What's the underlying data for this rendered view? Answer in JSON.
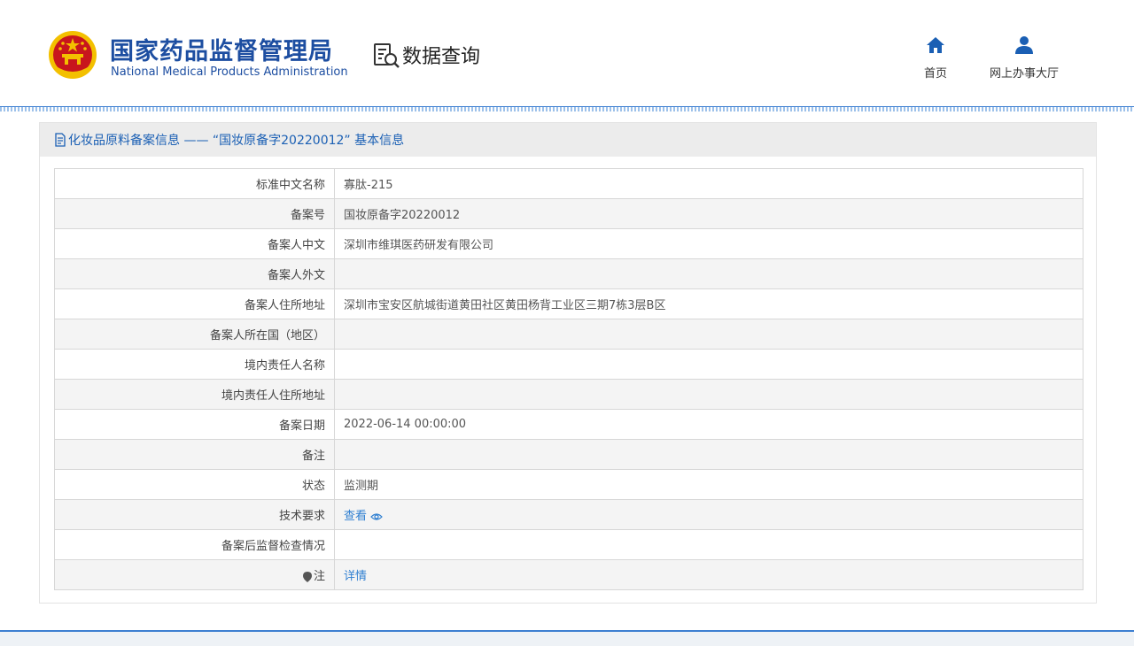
{
  "header": {
    "brand_cn": "国家药品监督管理局",
    "brand_en": "National Medical Products Administration",
    "query_label": "数据查询",
    "nav": {
      "home_label": "首页",
      "hall_label": "网上办事大厅"
    }
  },
  "panel": {
    "title": "化妆品原料备案信息 ——  “国妆原备字20220012”  基本信息"
  },
  "rows": [
    {
      "key": "标准中文名称",
      "value": "寡肽-215"
    },
    {
      "key": "备案号",
      "value": "国妆原备字20220012"
    },
    {
      "key": "备案人中文",
      "value": "深圳市维琪医药研发有限公司"
    },
    {
      "key": "备案人外文",
      "value": ""
    },
    {
      "key": "备案人住所地址",
      "value": "深圳市宝安区航城街道黄田社区黄田杨背工业区三期7栋3层B区"
    },
    {
      "key": "备案人所在国（地区）",
      "value": ""
    },
    {
      "key": "境内责任人名称",
      "value": ""
    },
    {
      "key": "境内责任人住所地址",
      "value": ""
    },
    {
      "key": "备案日期",
      "value": "2022-06-14 00:00:00"
    },
    {
      "key": "备注",
      "value": ""
    },
    {
      "key": "状态",
      "value": "监测期"
    },
    {
      "key": "技术要求",
      "value": "查看"
    },
    {
      "key": "备案后监督检查情况",
      "value": ""
    },
    {
      "key": "注",
      "value": "详情"
    }
  ],
  "icons": {
    "emblem": "national-emblem-icon",
    "query": "search-document-icon",
    "home": "home-icon",
    "hall": "user-icon",
    "title": "document-icon",
    "view": "eye-icon",
    "note": "pin-icon"
  },
  "colors": {
    "brand_blue": "#1d4ea1",
    "link_blue": "#2f7fd1",
    "emblem_red": "#c8161d",
    "emblem_gold": "#f3c000"
  }
}
